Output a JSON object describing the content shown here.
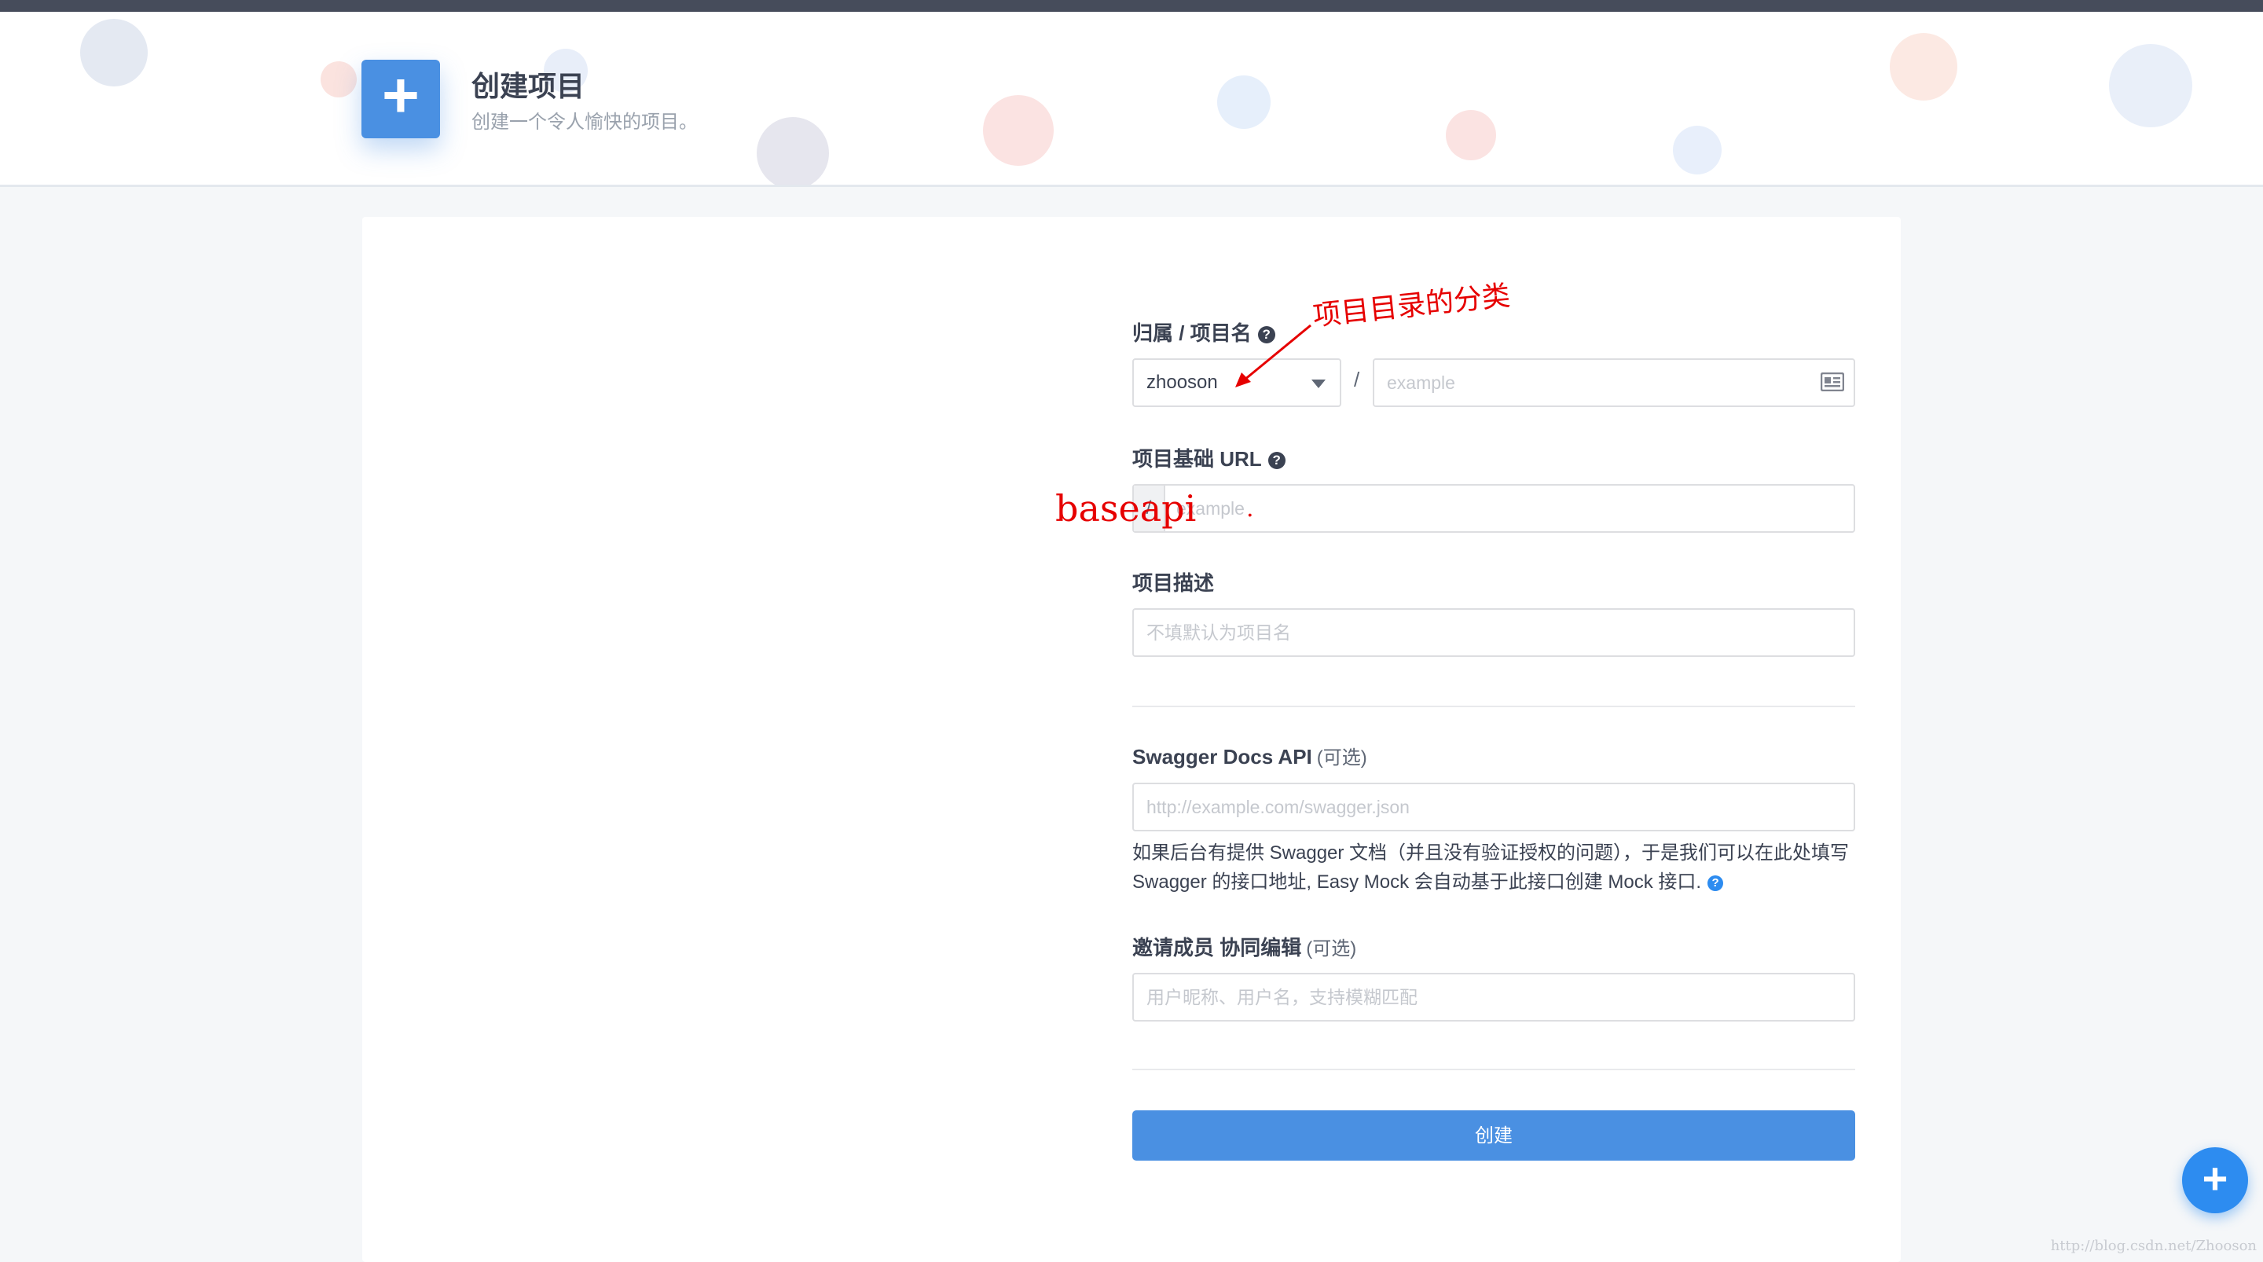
{
  "header": {
    "title": "创建项目",
    "subtitle": "创建一个令人愉快的项目。",
    "icon": "plus-icon"
  },
  "form": {
    "owner_label": "归属 / 项目名",
    "owner_value": "zhooson",
    "separator": "/",
    "name_placeholder": "example",
    "url_label": "项目基础 URL",
    "url_prefix": "/",
    "url_placeholder": "example",
    "desc_label": "项目描述",
    "desc_placeholder": "不填默认为项目名",
    "swagger_label": "Swagger Docs API",
    "optional": "(可选)",
    "swagger_placeholder": "http://example.com/swagger.json",
    "swagger_help_line1": "如果后台有提供 Swagger 文档（并且没有验证授权的问题），于是我们可以在此处填写",
    "swagger_help_line2": "Swagger 的接口地址, Easy Mock 会自动基于此接口创建 Mock 接口.",
    "members_label": "邀请成员 协同编辑",
    "members_placeholder": "用户昵称、用户名，支持模糊匹配",
    "create_button": "创建",
    "help_glyph": "?"
  },
  "annotations": {
    "category_note": "项目目录的分类",
    "baseapi_note": "baseapi",
    "dot": "."
  },
  "fab_label": "+",
  "watermark": "http://blog.csdn.net/Zhooson",
  "colors": {
    "primary": "#4a90e2",
    "annotation_red": "#e60000",
    "topbar": "#464c5b"
  }
}
